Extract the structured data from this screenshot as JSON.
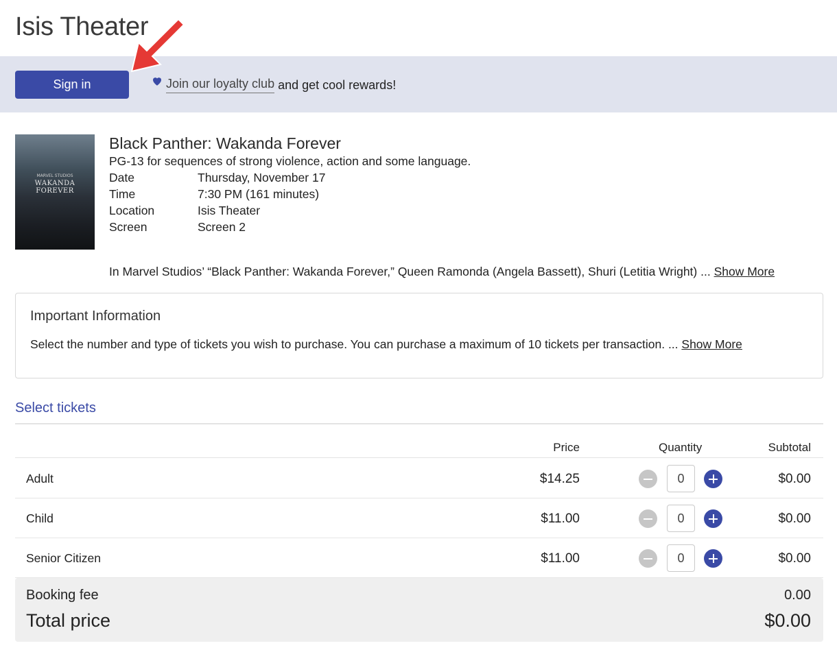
{
  "site": {
    "title": "Isis Theater"
  },
  "header": {
    "signin_label": "Sign in",
    "loyalty_link": "Join our loyalty club",
    "loyalty_suffix": "and get cool rewards!"
  },
  "movie": {
    "title": "Black Panther: Wakanda Forever",
    "rating": "PG-13 for sequences of strong violence, action and some language.",
    "poster_text": "WAKANDA FOREVER",
    "details": [
      {
        "label": "Date",
        "value": "Thursday, November 17"
      },
      {
        "label": "Time",
        "value": "7:30 PM (161 minutes)"
      },
      {
        "label": "Location",
        "value": "Isis Theater"
      },
      {
        "label": "Screen",
        "value": "Screen 2"
      }
    ],
    "synopsis": "In Marvel Studios’ “Black Panther: Wakanda Forever,” Queen Ramonda (Angela Bassett), Shuri (Letitia Wright) ...",
    "show_more": "Show More"
  },
  "important": {
    "title": "Important Information",
    "text": "Select the number and type of tickets you wish to purchase. You can purchase a maximum of 10 tickets per transaction. ...",
    "show_more": "Show More"
  },
  "tickets": {
    "section_title": "Select tickets",
    "headers": {
      "price": "Price",
      "quantity": "Quantity",
      "subtotal": "Subtotal"
    },
    "rows": [
      {
        "name": "Adult",
        "price": "$14.25",
        "quantity": "0",
        "subtotal": "$0.00"
      },
      {
        "name": "Child",
        "price": "$11.00",
        "quantity": "0",
        "subtotal": "$0.00"
      },
      {
        "name": "Senior Citizen",
        "price": "$11.00",
        "quantity": "0",
        "subtotal": "$0.00"
      }
    ]
  },
  "totals": {
    "fee_label": "Booking fee",
    "fee_value": "0.00",
    "total_label": "Total price",
    "total_value": "$0.00"
  },
  "colors": {
    "accent": "#3a4aa6",
    "band": "#e0e3ee",
    "annotation_arrow": "#e53935"
  },
  "icons": [
    "heart-icon",
    "minus-icon",
    "plus-icon",
    "red-arrow-annotation"
  ]
}
